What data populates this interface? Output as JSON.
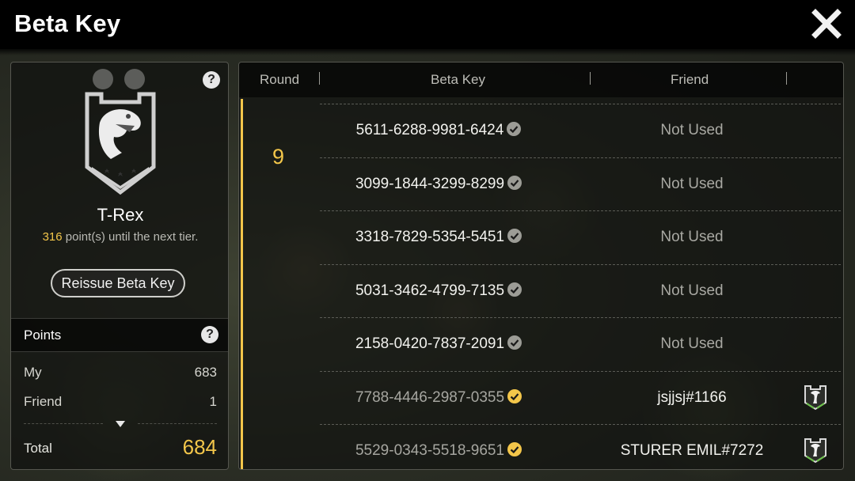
{
  "window": {
    "title": "Beta Key",
    "close_icon": "close-x-icon"
  },
  "tier": {
    "name": "T-Rex",
    "points_needed": "316",
    "points_suffix": " point(s) until the next tier.",
    "badge_icon": "trex-shield-icon",
    "reissue_label": "Reissue Beta Key"
  },
  "points": {
    "header": "Points",
    "my_label": "My",
    "my_value": "683",
    "friend_label": "Friend",
    "friend_value": "1",
    "total_label": "Total",
    "total_value": "684"
  },
  "table": {
    "col_round": "Round",
    "col_key": "Beta Key",
    "col_friend": "Friend",
    "round": "9",
    "rows": [
      {
        "key": "5611-6288-9981-6424",
        "friend": "Not Used",
        "used": false
      },
      {
        "key": "3099-1844-3299-8299",
        "friend": "Not Used",
        "used": false
      },
      {
        "key": "3318-7829-5354-5451",
        "friend": "Not Used",
        "used": false
      },
      {
        "key": "5031-3462-4799-7135",
        "friend": "Not Used",
        "used": false
      },
      {
        "key": "2158-0420-7837-2091",
        "friend": "Not Used",
        "used": false
      },
      {
        "key": "7788-4446-2987-0355",
        "friend": "jsjjsj#1166",
        "used": true
      },
      {
        "key": "5529-0343-5518-9651",
        "friend": "STURER EMIL#7272",
        "used": true
      }
    ]
  },
  "colors": {
    "accent_gold": "#f3c64a",
    "check_gray": "#9c9c96"
  }
}
